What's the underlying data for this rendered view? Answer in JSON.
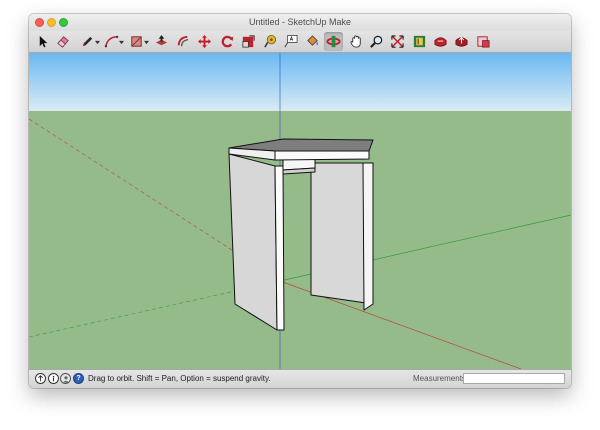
{
  "window": {
    "title": "Untitled - SketchUp Make"
  },
  "toolbar": {
    "tools": [
      {
        "name": "select-tool",
        "icon": "arrow-cursor-icon"
      },
      {
        "name": "eraser-tool",
        "icon": "eraser-icon"
      },
      {
        "name": "line-tool",
        "icon": "pencil-icon",
        "dropdown": true
      },
      {
        "name": "arc-tool",
        "icon": "arc-icon",
        "dropdown": true
      },
      {
        "name": "shape-tool",
        "icon": "rectangle-icon",
        "dropdown": true
      },
      {
        "name": "push-pull-tool",
        "icon": "push-pull-icon"
      },
      {
        "name": "offset-tool",
        "icon": "offset-icon"
      },
      {
        "name": "move-tool",
        "icon": "move-arrows-icon"
      },
      {
        "name": "rotate-tool",
        "icon": "rotate-icon"
      },
      {
        "name": "scale-tool",
        "icon": "scale-icon"
      },
      {
        "name": "tape-measure-tool",
        "icon": "tape-measure-icon"
      },
      {
        "name": "text-tool",
        "icon": "text-label-icon"
      },
      {
        "name": "paint-bucket-tool",
        "icon": "paint-bucket-icon"
      },
      {
        "name": "orbit-tool",
        "icon": "orbit-icon",
        "active": true
      },
      {
        "name": "pan-tool",
        "icon": "hand-icon"
      },
      {
        "name": "zoom-tool",
        "icon": "magnifier-icon"
      },
      {
        "name": "zoom-extents-tool",
        "icon": "zoom-extents-icon"
      },
      {
        "name": "warehouse-tool",
        "icon": "3d-warehouse-icon"
      },
      {
        "name": "extension-warehouse-tool",
        "icon": "extension-warehouse-icon"
      },
      {
        "name": "share-model-tool",
        "icon": "share-model-icon"
      },
      {
        "name": "layout-tool",
        "icon": "layout-icon"
      }
    ]
  },
  "colors": {
    "sky_top": "#69b8f2",
    "sky_bottom": "#dcebf5",
    "ground": "#96bb8a",
    "axis_red": "#b04a3c",
    "axis_green": "#2e9c3a",
    "axis_blue": "#3a5fd0",
    "toolbar_accent": "#c0202c"
  },
  "status": {
    "hint": "Drag to orbit. Shift = Pan, Option = suspend gravity.",
    "measurements_label": "Measurements",
    "measurements_value": ""
  }
}
